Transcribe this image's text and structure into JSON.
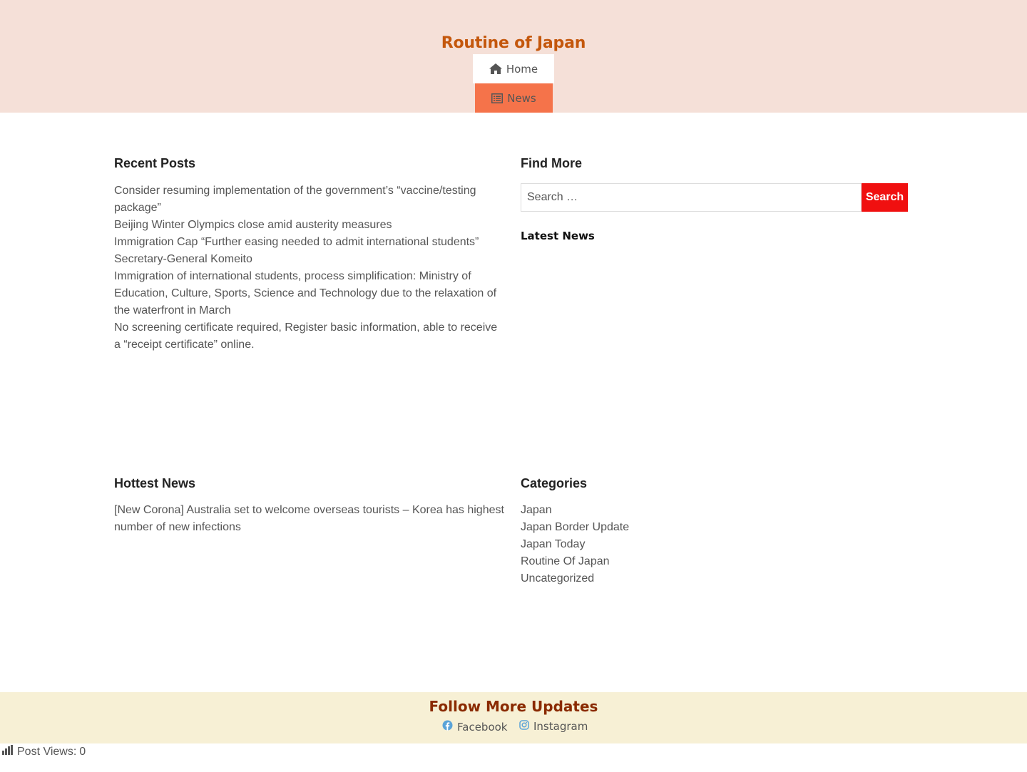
{
  "header": {
    "site_title": "Routine of Japan",
    "nav": [
      {
        "label": "Home",
        "icon": "home-icon"
      },
      {
        "label": "News",
        "icon": "news-list-icon",
        "active": true
      }
    ]
  },
  "recent_posts": {
    "title": "Recent Posts",
    "items": [
      "Consider resuming implementation of the government’s “vaccine/testing package”",
      "Beijing Winter Olympics close amid austerity measures",
      "Immigration Cap “Further easing needed to admit international students” Secretary-General Komeito",
      "Immigration of international students, process simplification: Ministry of Education, Culture, Sports, Science and Technology due to the relaxation of the waterfront in March",
      "No screening certificate required, Register basic information, able to receive a “receipt certificate” online."
    ]
  },
  "find_more": {
    "title": "Find More",
    "search_placeholder": "Search …",
    "search_button": "Search",
    "latest_title": "Latest News"
  },
  "hottest_news": {
    "title": "Hottest News",
    "items": [
      "[New Corona] Australia set to welcome overseas tourists – Korea has highest number of new infections"
    ]
  },
  "categories": {
    "title": "Categories",
    "items": [
      "Japan",
      "Japan Border Update",
      "Japan Today",
      "Routine Of Japan",
      "Uncategorized"
    ]
  },
  "footer": {
    "title": "Follow More Updates",
    "links": [
      {
        "label": "Facebook",
        "icon": "facebook-icon"
      },
      {
        "label": "Instagram",
        "icon": "instagram-icon"
      }
    ]
  },
  "post_views": {
    "label": "Post Views:",
    "count": "0"
  },
  "colors": {
    "header_bg": "#f5e0d8",
    "title": "#c4570c",
    "nav_active": "#f5734a",
    "search_button": "#f01010",
    "footer_bg": "#f7f0d5",
    "footer_title": "#8a2a00"
  }
}
